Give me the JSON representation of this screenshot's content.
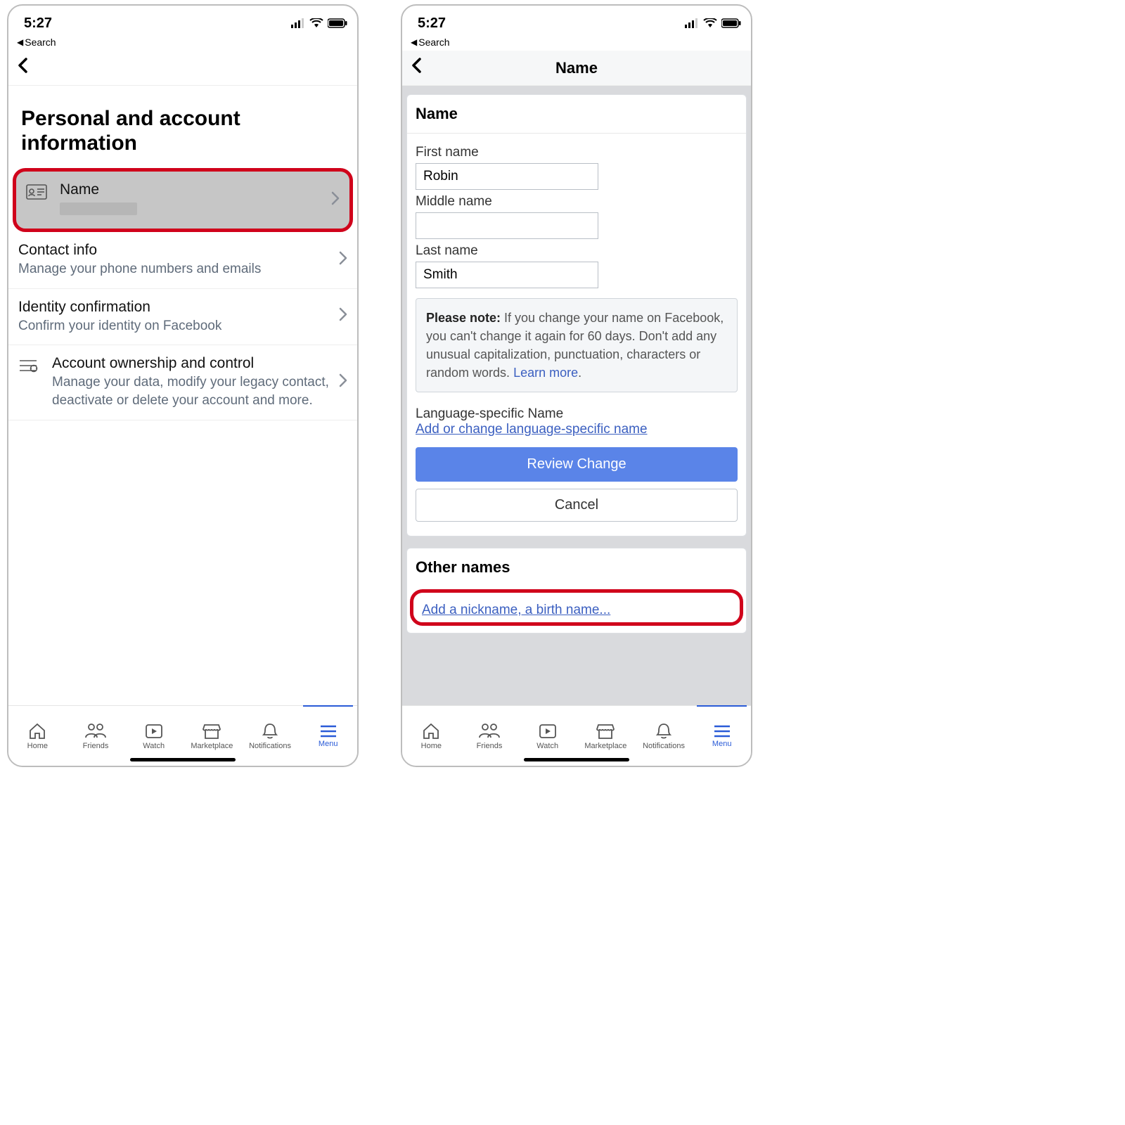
{
  "status": {
    "time": "5:27",
    "breadcrumb": "Search"
  },
  "screen1": {
    "page_title": "Personal and account information",
    "rows": [
      {
        "title": "Name",
        "sub": ""
      },
      {
        "title": "Contact info",
        "sub": "Manage your phone numbers and emails"
      },
      {
        "title": "Identity confirmation",
        "sub": "Confirm your identity on Facebook"
      },
      {
        "title": "Account ownership and control",
        "sub": "Manage your data, modify your legacy contact, deactivate or delete your account and more."
      }
    ]
  },
  "screen2": {
    "header_title": "Name",
    "name_card_title": "Name",
    "fields": {
      "first": {
        "label": "First name",
        "value": "Robin"
      },
      "middle": {
        "label": "Middle name",
        "value": ""
      },
      "last": {
        "label": "Last name",
        "value": "Smith"
      }
    },
    "note_bold": "Please note:",
    "note_text": " If you change your name on Facebook, you can't change it again for 60 days. Don't add any unusual capitalization, punctuation, characters or random words. ",
    "note_link": "Learn more",
    "lang_title": "Language-specific Name",
    "lang_link": "Add or change language-specific name",
    "review_btn": "Review Change",
    "cancel_btn": "Cancel",
    "other_card_title": "Other names",
    "other_link": "Add a nickname, a birth name..."
  },
  "tabs": [
    {
      "label": "Home"
    },
    {
      "label": "Friends"
    },
    {
      "label": "Watch"
    },
    {
      "label": "Marketplace"
    },
    {
      "label": "Notifications"
    },
    {
      "label": "Menu"
    }
  ]
}
